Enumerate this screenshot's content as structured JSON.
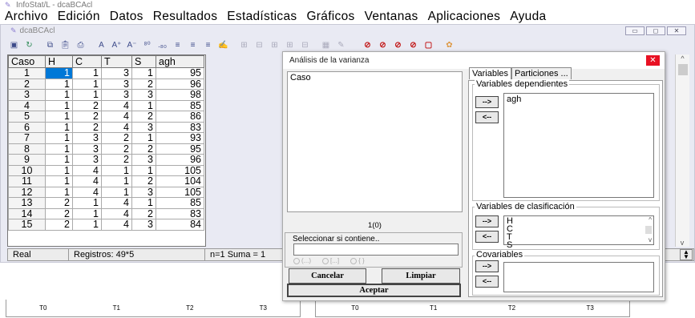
{
  "app": {
    "title": "InfoStat/L - dcaBCAcl"
  },
  "menu": [
    "Archivo",
    "Edición",
    "Datos",
    "Resultados",
    "Estadísticas",
    "Gráficos",
    "Ventanas",
    "Aplicaciones",
    "Ayuda"
  ],
  "doc": {
    "title": "dcaBCAcl"
  },
  "grid": {
    "headers": [
      "Caso",
      "H",
      "C",
      "T",
      "S",
      "agh"
    ],
    "rows": [
      [
        "1",
        "1",
        "1",
        "3",
        "1",
        "95"
      ],
      [
        "2",
        "1",
        "1",
        "3",
        "2",
        "96"
      ],
      [
        "3",
        "1",
        "1",
        "3",
        "3",
        "98"
      ],
      [
        "4",
        "1",
        "2",
        "4",
        "1",
        "85"
      ],
      [
        "5",
        "1",
        "2",
        "4",
        "2",
        "86"
      ],
      [
        "6",
        "1",
        "2",
        "4",
        "3",
        "83"
      ],
      [
        "7",
        "1",
        "3",
        "2",
        "1",
        "93"
      ],
      [
        "8",
        "1",
        "3",
        "2",
        "2",
        "95"
      ],
      [
        "9",
        "1",
        "3",
        "2",
        "3",
        "96"
      ],
      [
        "10",
        "1",
        "4",
        "1",
        "1",
        "105"
      ],
      [
        "11",
        "1",
        "4",
        "1",
        "2",
        "104"
      ],
      [
        "12",
        "1",
        "4",
        "1",
        "3",
        "105"
      ],
      [
        "13",
        "2",
        "1",
        "4",
        "1",
        "85"
      ],
      [
        "14",
        "2",
        "1",
        "4",
        "2",
        "83"
      ],
      [
        "15",
        "2",
        "1",
        "4",
        "3",
        "84"
      ]
    ]
  },
  "status": {
    "mode": "Real",
    "records": "Registros: 49*5",
    "summary": "n=1  Suma = 1"
  },
  "dialog": {
    "title": "Análisis de la varianza",
    "variables": [
      "Caso"
    ],
    "count": "1(0)",
    "filter_label": "Seleccionar si contiene..",
    "radio_labels": [
      "(...)",
      "[...]",
      "{ }"
    ],
    "cancel": "Cancelar",
    "clear": "Limpiar",
    "accept": "Aceptar",
    "tabs": [
      "Variables",
      "Particiones ..."
    ],
    "dependent_label": "Variables dependientes",
    "dependent": [
      "agh"
    ],
    "class_label": "Variables de clasificación",
    "class_vars": [
      "H",
      "C",
      "T",
      "S"
    ],
    "cov_label": "Covariables",
    "add_arrow": "-->",
    "remove_arrow": "<--"
  },
  "bottom": {
    "left": [
      "T0",
      "T1",
      "T2",
      "T3"
    ],
    "right": [
      "T0",
      "T1",
      "T2",
      "T3"
    ]
  }
}
